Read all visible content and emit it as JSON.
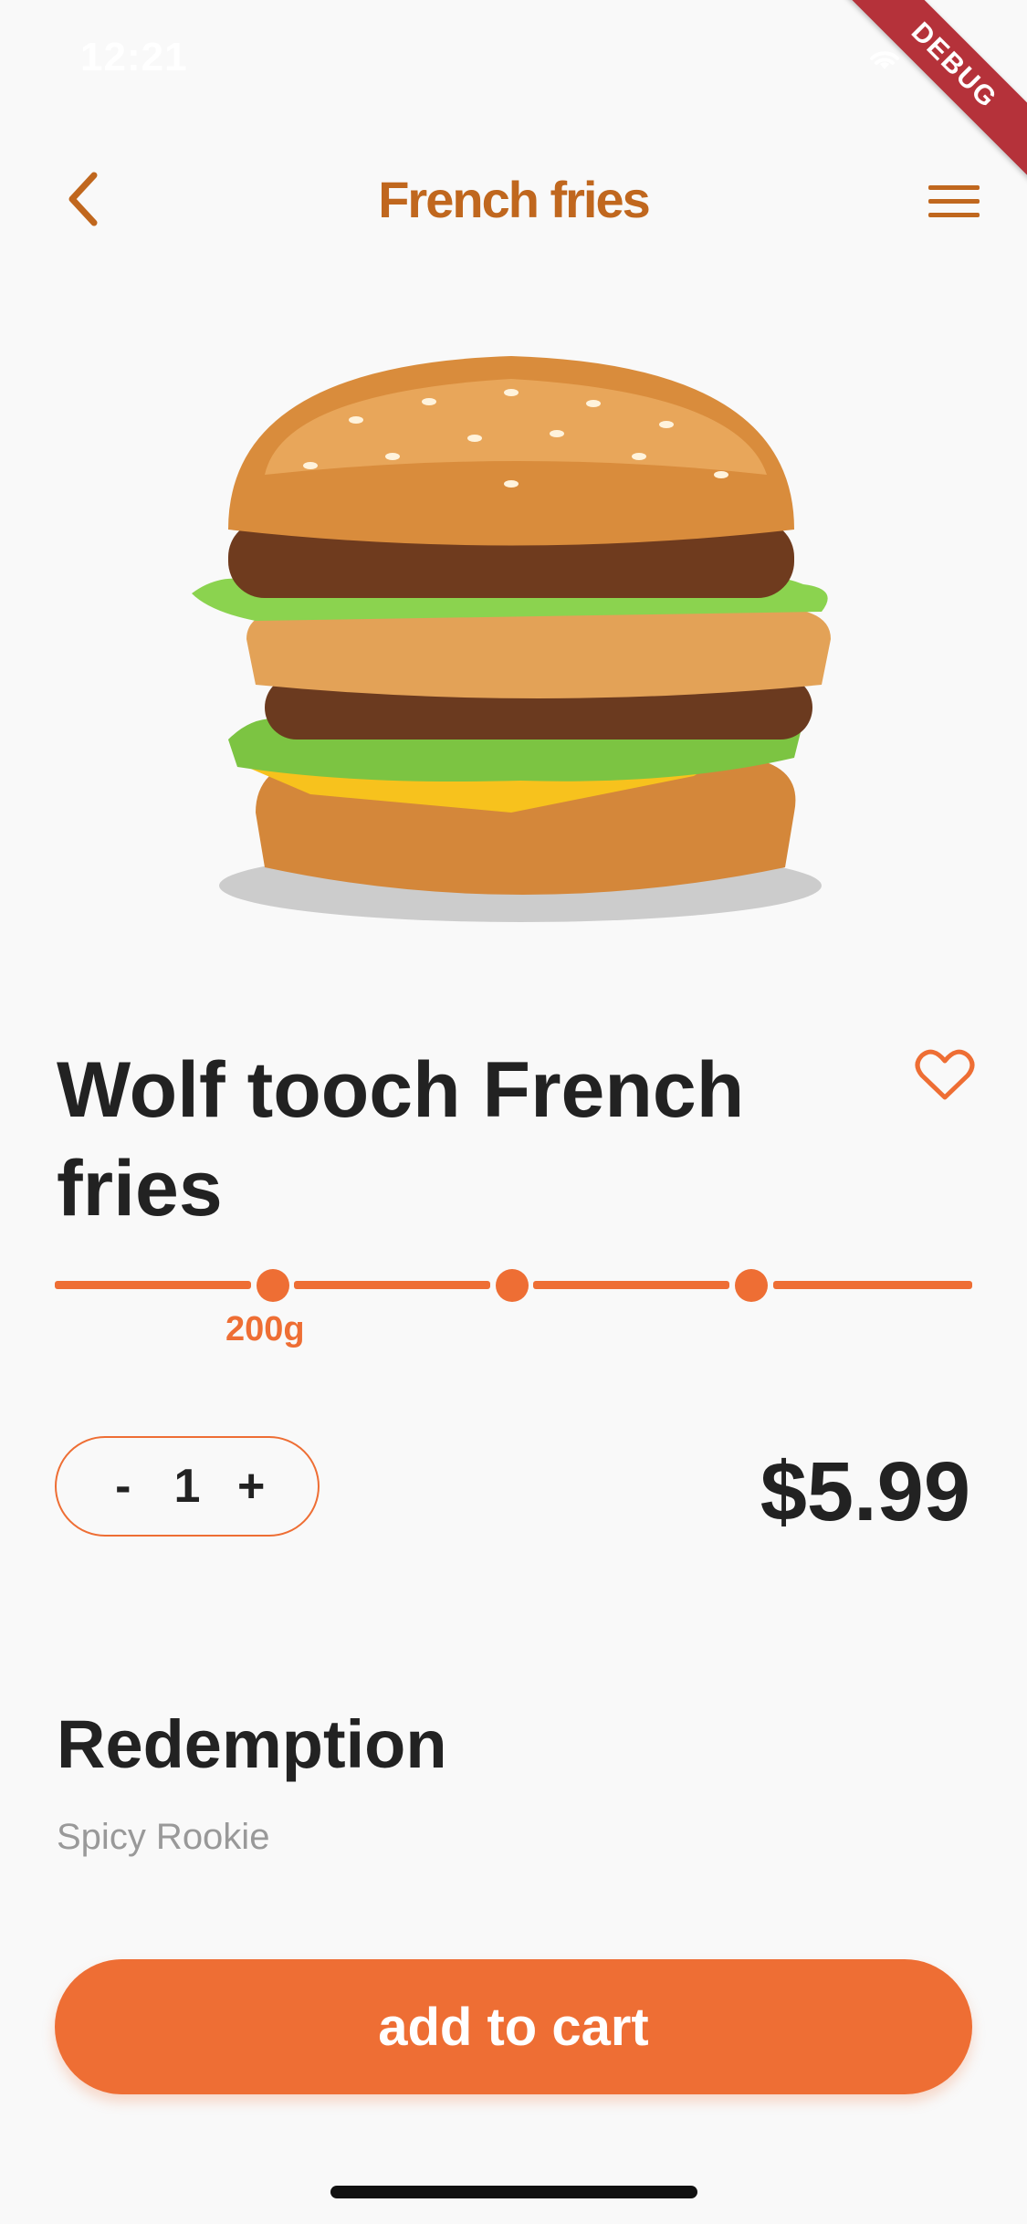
{
  "status_bar": {
    "time": "12:21",
    "wifi_icon": "wifi-icon",
    "battery_icon": "battery-icon"
  },
  "debug_ribbon": "DEBUG",
  "nav": {
    "title": "French fries",
    "back_icon": "chevron-left-icon",
    "menu_icon": "hamburger-menu-icon"
  },
  "colors": {
    "accent": "#ee6e34",
    "nav_title": "#c0671e",
    "background": "#f9f9f9",
    "text": "#222222",
    "muted": "#999999"
  },
  "product": {
    "title": "Wolf tooch French fries",
    "favorite_icon": "heart-outline-icon",
    "image": "burger-image",
    "size_options": [
      "200g",
      "",
      ""
    ],
    "selected_size": "200g",
    "quantity": {
      "minus": "-",
      "value": "1",
      "plus": "+"
    },
    "price": "$5.99"
  },
  "redemption": {
    "title": "Redemption",
    "subtitle": "Spicy Rookie"
  },
  "cart_button": "add to cart"
}
